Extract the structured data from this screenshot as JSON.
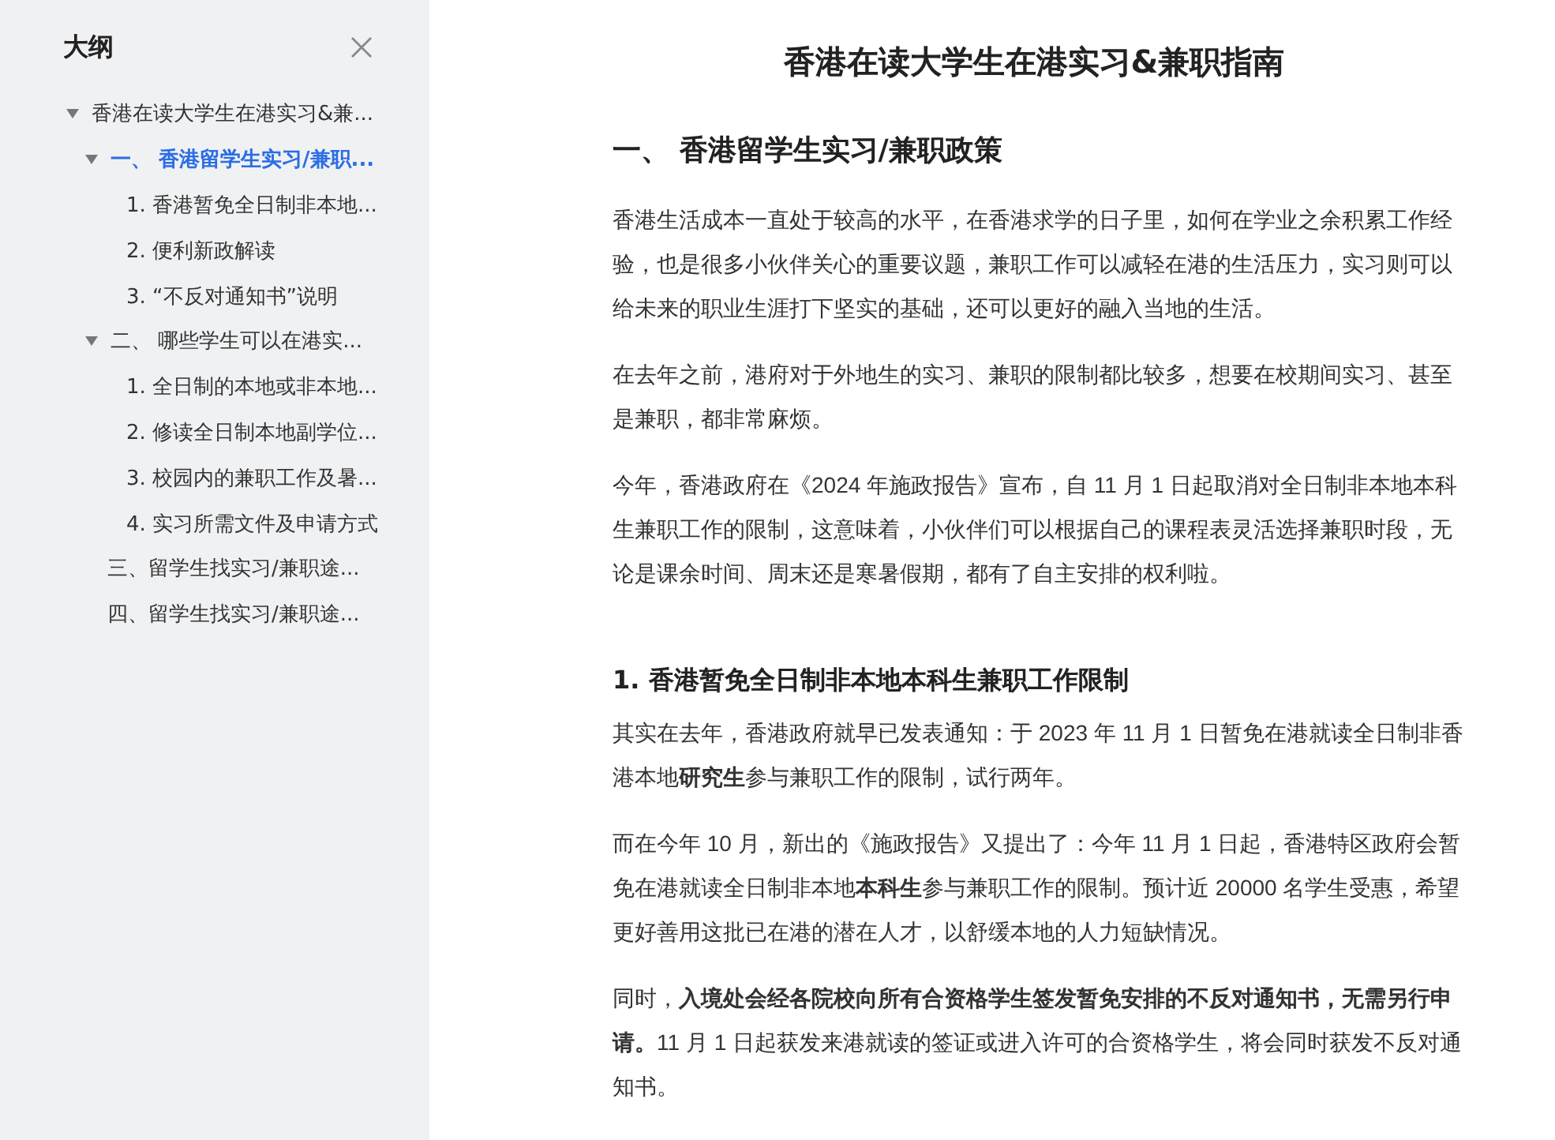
{
  "outline": {
    "title": "大纲",
    "items": [
      {
        "label": "香港在读大学生在港实习&兼...",
        "selected": false,
        "expanded": true,
        "children": [
          {
            "label": "一、 香港留学生实习/兼职...",
            "selected": true,
            "expanded": true,
            "children": [
              {
                "label": "1. 香港暂免全日制非本地...",
                "selected": false
              },
              {
                "label": "2. 便利新政解读",
                "selected": false
              },
              {
                "label": "3. “不反对通知书”说明",
                "selected": false
              }
            ]
          },
          {
            "label": "二、 哪些学生可以在港实...",
            "selected": false,
            "expanded": true,
            "children": [
              {
                "label": "1. 全日制的本地或非本地...",
                "selected": false
              },
              {
                "label": "2. 修读全日制本地副学位...",
                "selected": false
              },
              {
                "label": "3. 校园内的兼职工作及暑...",
                "selected": false
              },
              {
                "label": "4. 实习所需文件及申请方式",
                "selected": false
              }
            ]
          },
          {
            "label": "三、留学生找实习/兼职途...",
            "selected": false
          },
          {
            "label": "四、留学生找实习/兼职途...",
            "selected": false
          }
        ]
      }
    ]
  },
  "document": {
    "title": "香港在读大学生在港实习&兼职指南",
    "blocks": [
      {
        "kind": "h2",
        "text": "一、 香港留学生实习/兼职政策"
      },
      {
        "kind": "p",
        "text": "香港生活成本一直处于较高的水平，在香港求学的日子里，如何在学业之余积累工作经验，也是很多小伙伴关心的重要议题，兼职工作可以减轻在港的生活压力，实习则可以给未来的职业生涯打下坚实的基础，还可以更好的融入当地的生活。"
      },
      {
        "kind": "p",
        "text": "在去年之前，港府对于外地生的实习、兼职的限制都比较多，想要在校期间实习、甚至是兼职，都非常麻烦。"
      },
      {
        "kind": "p",
        "text": "今年，香港政府在《2024 年施政报告》宣布，自 11 月 1 日起取消对全日制非本地本科生兼职工作的限制，这意味着，小伙伴们可以根据自己的课程表灵活选择兼职时段，无论是课余时间、周末还是寒暑假期，都有了自主安排的权利啦。"
      },
      {
        "kind": "h3",
        "text": "1. 香港暂免全日制非本地本科生兼职工作限制"
      },
      {
        "kind": "p",
        "text": "其实在去年，香港政府就早已发表通知：于 2023 年 11 月 1 日暂免在港就读全日制非香港本地**研究生**参与兼职工作的限制，试行两年。"
      },
      {
        "kind": "p",
        "text": "而在今年 10 月，新出的《施政报告》又提出了：今年 11 月 1 日起，香港特区政府会暂免在港就读全日制非本地**本科生**参与兼职工作的限制。预计近 20000 名学生受惠，希望更好善用这批已在港的潜在人才，以舒缓本地的人力短缺情况。"
      },
      {
        "kind": "p",
        "text": "同时，**入境处会经各院校向所有合资格学生签发暂免安排的不反对通知书，无需另行申请。**11 月 1 日起获发来港就读的签证或进入许可的合资格学生，将会同时获发不反对通知书。"
      }
    ]
  }
}
